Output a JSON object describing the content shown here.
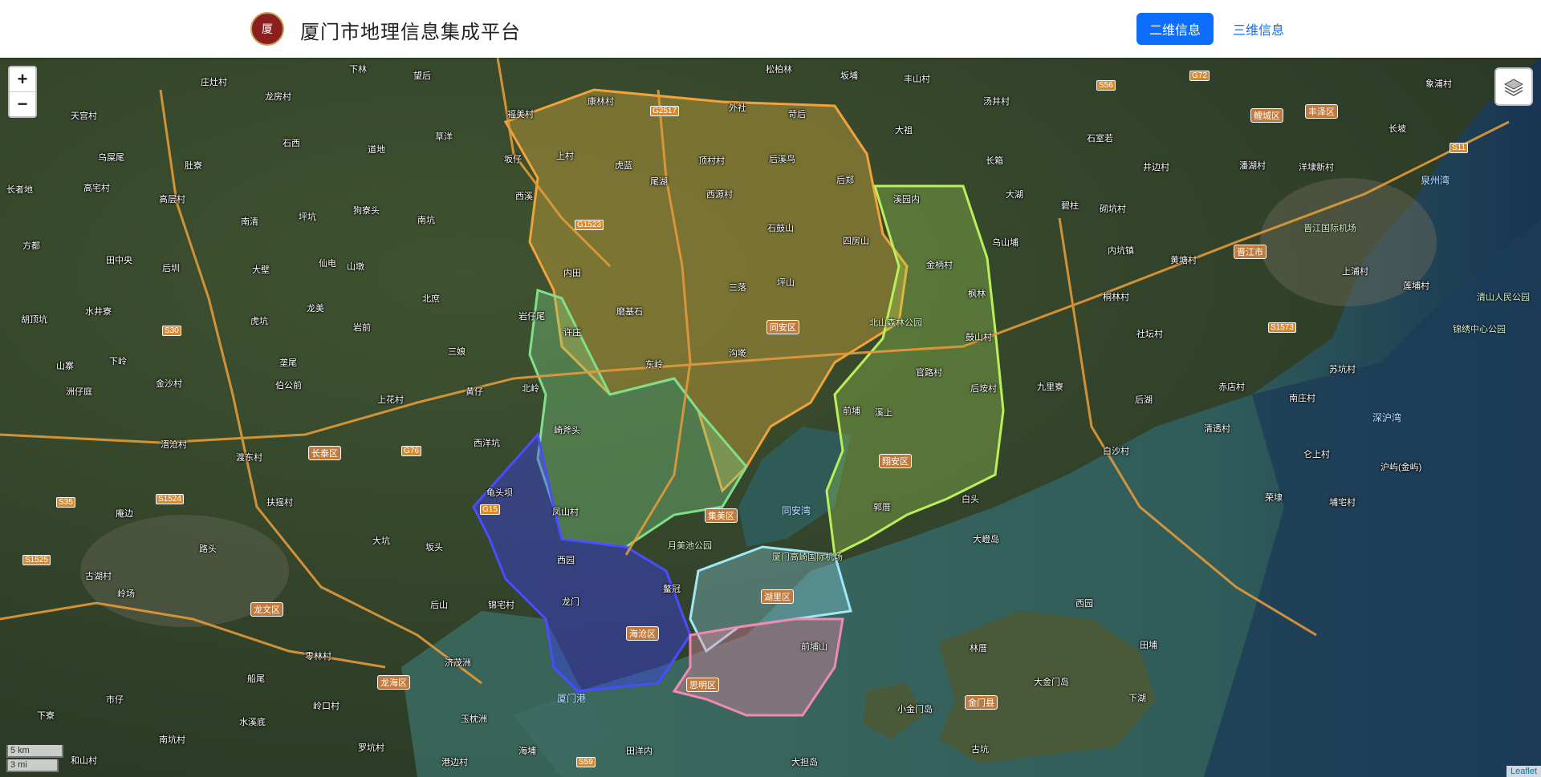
{
  "header": {
    "logo_text": "厦",
    "title": "厦门市地理信息集成平台",
    "nav": [
      {
        "label": "二维信息",
        "active": true
      },
      {
        "label": "三维信息",
        "active": false
      }
    ]
  },
  "map": {
    "zoom_in": "+",
    "zoom_out": "−",
    "scale_km": "5 km",
    "scale_mi": "3 mi",
    "attribution": "Leaflet",
    "layers_icon": "layers-icon",
    "colors": {
      "land": "#3a4a2a",
      "sea": "#2f5b5a",
      "deep_sea": "#16304a",
      "tongan": "#c8a23a",
      "jimei": "#7fd38a",
      "xiangan": "#a8e05a",
      "haicang": "#3a3cff",
      "huli": "#8fd8e8",
      "siming": "#e88aa8"
    },
    "districts": [
      {
        "name": "同安区"
      },
      {
        "name": "集美区"
      },
      {
        "name": "翔安区"
      },
      {
        "name": "海沧区"
      },
      {
        "name": "湖里区"
      },
      {
        "name": "思明区"
      },
      {
        "name": "长泰区"
      },
      {
        "name": "龙文区"
      },
      {
        "name": "龙海区"
      },
      {
        "name": "金门县"
      },
      {
        "name": "鲤城区"
      },
      {
        "name": "丰泽区"
      },
      {
        "name": "晋江市"
      }
    ],
    "places": [
      {
        "name": "庄灶村"
      },
      {
        "name": "龙房村"
      },
      {
        "name": "下林"
      },
      {
        "name": "望后"
      },
      {
        "name": "松柏林"
      },
      {
        "name": "坂埔"
      },
      {
        "name": "丰山村"
      },
      {
        "name": "天宫村"
      },
      {
        "name": "福美村"
      },
      {
        "name": "康林村"
      },
      {
        "name": "外社"
      },
      {
        "name": "汤井村"
      },
      {
        "name": "苛后"
      },
      {
        "name": "乌屎尾"
      },
      {
        "name": "石西"
      },
      {
        "name": "道地"
      },
      {
        "name": "草洋"
      },
      {
        "name": "大祖"
      },
      {
        "name": "长箱"
      },
      {
        "name": "长者地"
      },
      {
        "name": "肚寮"
      },
      {
        "name": "坂仔"
      },
      {
        "name": "上村"
      },
      {
        "name": "虎蓝"
      },
      {
        "name": "顶村村"
      },
      {
        "name": "后溪鸟"
      },
      {
        "name": "高宅村"
      },
      {
        "name": "高层村"
      },
      {
        "name": "尾湖"
      },
      {
        "name": "后郑"
      },
      {
        "name": "西源村"
      },
      {
        "name": "溪园内"
      },
      {
        "name": "南清"
      },
      {
        "name": "坪坑"
      },
      {
        "name": "狗寮头"
      },
      {
        "name": "南坑"
      },
      {
        "name": "西溪"
      },
      {
        "name": "大湖"
      },
      {
        "name": "方都"
      },
      {
        "name": "石鼓山"
      },
      {
        "name": "四房山"
      },
      {
        "name": "金柄村"
      },
      {
        "name": "乌山埔"
      },
      {
        "name": "田中央"
      },
      {
        "name": "后圳"
      },
      {
        "name": "大壁"
      },
      {
        "name": "仙电"
      },
      {
        "name": "山墩"
      },
      {
        "name": "内田"
      },
      {
        "name": "三落"
      },
      {
        "name": "坪山"
      },
      {
        "name": "北庶"
      },
      {
        "name": "胡顶坑"
      },
      {
        "name": "水井寮"
      },
      {
        "name": "虎坑"
      },
      {
        "name": "龙美"
      },
      {
        "name": "岩仔尾"
      },
      {
        "name": "磨基石"
      },
      {
        "name": "许庄"
      },
      {
        "name": "枫林"
      },
      {
        "name": "岩前"
      },
      {
        "name": "三娘"
      },
      {
        "name": "下岭"
      },
      {
        "name": "山寨"
      },
      {
        "name": "垄尾"
      },
      {
        "name": "东岭"
      },
      {
        "name": "沟墘"
      },
      {
        "name": "鼓山村"
      },
      {
        "name": "金沙村"
      },
      {
        "name": "伯公前"
      },
      {
        "name": "北岭"
      },
      {
        "name": "黄仔"
      },
      {
        "name": "洲仔庭"
      },
      {
        "name": "官路村"
      },
      {
        "name": "后垵村"
      },
      {
        "name": "上花村"
      },
      {
        "name": "前埔"
      },
      {
        "name": "溪上"
      },
      {
        "name": "崎斧头"
      },
      {
        "name": "西洋坑"
      },
      {
        "name": "浯沧村"
      },
      {
        "name": "渡东村"
      },
      {
        "name": "龟头坝"
      },
      {
        "name": "凤山村"
      },
      {
        "name": "郭厝"
      },
      {
        "name": "白头"
      },
      {
        "name": "扶摇村"
      },
      {
        "name": "大坑"
      },
      {
        "name": "庵边"
      },
      {
        "name": "坂头"
      },
      {
        "name": "大嶝岛"
      },
      {
        "name": "路头"
      },
      {
        "name": "西园"
      },
      {
        "name": "古湖村"
      },
      {
        "name": "岭场"
      },
      {
        "name": "后山"
      },
      {
        "name": "锦宅村"
      },
      {
        "name": "龙门"
      },
      {
        "name": "鳌冠"
      },
      {
        "name": "零林村"
      },
      {
        "name": "船尾"
      },
      {
        "name": "济茂洲"
      },
      {
        "name": "西园"
      },
      {
        "name": "林厝"
      },
      {
        "name": "田埔"
      },
      {
        "name": "前埔山"
      },
      {
        "name": "市仔"
      },
      {
        "name": "岭口村"
      },
      {
        "name": "大金门岛"
      },
      {
        "name": "水溪底"
      },
      {
        "name": "玉枕洲"
      },
      {
        "name": "小金门岛"
      },
      {
        "name": "下湖"
      },
      {
        "name": "下寮"
      },
      {
        "name": "南坑村"
      },
      {
        "name": "罗坑村"
      },
      {
        "name": "古坑"
      },
      {
        "name": "和山村"
      },
      {
        "name": "港边村"
      },
      {
        "name": "海埔"
      },
      {
        "name": "田洋内"
      },
      {
        "name": "大担岛"
      },
      {
        "name": "石室若"
      },
      {
        "name": "井边村"
      },
      {
        "name": "潘湖村"
      },
      {
        "name": "洋埭新村"
      },
      {
        "name": "长坡"
      },
      {
        "name": "象浦村"
      },
      {
        "name": "碧柱"
      },
      {
        "name": "砌坑村"
      },
      {
        "name": "内坑镇"
      },
      {
        "name": "黄塘村"
      },
      {
        "name": "上浦村"
      },
      {
        "name": "莲埔村"
      },
      {
        "name": "桐林村"
      },
      {
        "name": "社坛村"
      },
      {
        "name": "九里寮"
      },
      {
        "name": "后湖"
      },
      {
        "name": "赤店村"
      },
      {
        "name": "苏坑村"
      },
      {
        "name": "清透村"
      },
      {
        "name": "白沙村"
      },
      {
        "name": "南庄村"
      },
      {
        "name": "仑上村"
      },
      {
        "name": "沪屿(金屿)"
      },
      {
        "name": "荣埭"
      },
      {
        "name": "埔宅村"
      }
    ],
    "water": [
      {
        "name": "同安湾"
      },
      {
        "name": "厦门港"
      },
      {
        "name": "泉州湾"
      },
      {
        "name": "深沪湾"
      }
    ],
    "pois": [
      {
        "name": "北山森林公园"
      },
      {
        "name": "月美池公园"
      },
      {
        "name": "厦门高崎国际机场"
      },
      {
        "name": "晋江国际机场"
      },
      {
        "name": "清山人民公园"
      },
      {
        "name": "锦绣中心公园"
      }
    ],
    "highways": [
      {
        "name": "G2517"
      },
      {
        "name": "G1523"
      },
      {
        "name": "G15"
      },
      {
        "name": "G72"
      },
      {
        "name": "G76"
      },
      {
        "name": "S56"
      },
      {
        "name": "S11"
      },
      {
        "name": "S30"
      },
      {
        "name": "S35"
      },
      {
        "name": "S1524"
      },
      {
        "name": "S1525"
      },
      {
        "name": "S1573"
      },
      {
        "name": "S59"
      }
    ]
  }
}
